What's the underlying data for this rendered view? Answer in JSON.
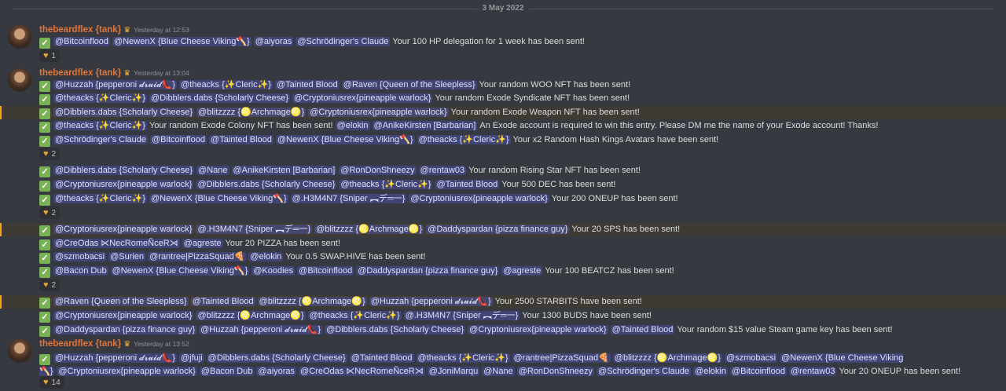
{
  "date_divider": "3 May 2022",
  "groups": [
    {
      "author": "thebeardflex {tank}",
      "timestamp": "Yesterday at 12:53",
      "lines": [
        {
          "mentions": [
            "@Bitcoinflood",
            "@NewenX {Blue Cheese Viking🪓}",
            "@aiyoras",
            "@Schrödinger's Claude"
          ],
          "text": "Your 100 HP delegation for 1 week has been sent!"
        }
      ],
      "reaction_count": "1"
    },
    {
      "author": "thebeardflex {tank}",
      "timestamp": "Yesterday at 13:04",
      "lines": [
        {
          "mentions": [
            "@Huzzah {pepperoni 𝓭𝓻𝓾𝓲𝓭👠}",
            "@theacks {✨Cleric✨}",
            "@Tainted Blood",
            "@Raven {Queen of the Sleepless}"
          ],
          "text": "Your random WOO NFT has been sent!"
        },
        {
          "mentions": [
            "@theacks {✨Cleric✨}",
            "@Dibblers.dabs {Scholarly Cheese}",
            "@Cryptoniusrex{pineapple warlock}"
          ],
          "text": "Your random Exode Syndicate NFT has been sent!"
        },
        {
          "mentions": [
            "@Dibblers.dabs {Scholarly Cheese}",
            "@blitzzzz {♌Archmage♌}",
            "@Cryptoniusrex{pineapple warlock}"
          ],
          "text": "Your random Exode Weapon NFT has been sent!"
        },
        {
          "mentions": [
            "@theacks {✨Cleric✨}"
          ],
          "text": "Your random Exode Colony NFT has been sent!",
          "mentions2": [
            "@elokin",
            "@AnikeKirsten [Barbarian]"
          ],
          "text2": "An Exode account is required to win this entry. Please DM me the name of your Exode account! Thanks!"
        },
        {
          "mentions": [
            "@Schrödinger's Claude",
            "@Bitcoinflood",
            "@Tainted Blood",
            "@NewenX {Blue Cheese Viking🪓}",
            "@theacks {✨Cleric✨}"
          ],
          "text": "Your x2 Random Hash Kings Avatars have been sent!"
        }
      ],
      "reaction_count": "2"
    },
    {
      "lines": [
        {
          "mentions": [
            "@Dibblers.dabs {Scholarly Cheese}",
            "@Nane",
            "@AnikeKirsten [Barbarian]",
            "@RonDonShneezy",
            "@rentaw03"
          ],
          "text": "Your random Rising Star NFT has been sent!"
        },
        {
          "mentions": [
            "@Cryptoniusrex{pineapple warlock}",
            "@Dibblers.dabs {Scholarly Cheese}",
            "@theacks {✨Cleric✨}",
            "@Tainted Blood"
          ],
          "text": "Your 500 DEC has been sent!"
        },
        {
          "mentions": [
            "@theacks {✨Cleric✨}",
            "@NewenX {Blue Cheese Viking🪓}",
            "@.H3M4N7 {Sniper ︻デ═一}",
            "@Cryptoniusrex{pineapple warlock}"
          ],
          "text": "Your 200 ONEUP has been sent!"
        }
      ],
      "reaction_count": "2"
    },
    {
      "lines": [
        {
          "mentions": [
            "@Cryptoniusrex{pineapple warlock}",
            "@.H3M4N7 {Sniper ︻デ═一}",
            "@blitzzzz {♌Archmage♌}",
            "@Daddyspardan {pizza finance guy}"
          ],
          "text": "Your 20 SPS has been sent!"
        },
        {
          "mentions": [
            "@CreOdas ⋉NecRomeÑceR⋊",
            "@agreste"
          ],
          "text": "Your 20 PIZZA has been sent!"
        },
        {
          "mentions": [
            "@szmobacsi",
            "@Surien",
            "@rantree|PizzaSquad🍕",
            "@elokin"
          ],
          "text": "Your 0.5 SWAP.HIVE has been sent!"
        },
        {
          "mentions": [
            "@Bacon Dub",
            "@NewenX {Blue Cheese Viking🪓}",
            "@Koodies",
            "@Bitcoinflood",
            "@Daddyspardan {pizza finance guy}",
            "@agreste"
          ],
          "text": "Your 100 BEATCZ has been sent!"
        }
      ],
      "reaction_count": "2"
    },
    {
      "lines": [
        {
          "mentions": [
            "@Raven {Queen of the Sleepless}",
            "@Tainted Blood",
            "@blitzzzz {♌Archmage♌}",
            "@Huzzah {pepperoni 𝓭𝓻𝓾𝓲𝓭👠}"
          ],
          "text": "Your 2500 STARBITS have been sent!"
        },
        {
          "mentions": [
            "@Cryptoniusrex{pineapple warlock}",
            "@blitzzzz {♌Archmage♌}",
            "@theacks {✨Cleric✨}",
            "@.H3M4N7 {Sniper ︻デ═一}"
          ],
          "text": "Your 1300 BUDS have been sent!"
        },
        {
          "mentions": [
            "@Daddyspardan {pizza finance guy}",
            "@Huzzah {pepperoni 𝓭𝓻𝓾𝓲𝓭👠}",
            "@Dibblers.dabs {Scholarly Cheese}",
            "@Cryptoniusrex{pineapple warlock}",
            "@Tainted Blood"
          ],
          "text": "Your random $15 value Steam game key has been sent!"
        }
      ]
    },
    {
      "author": "thebeardflex {tank}",
      "timestamp": "Yesterday at 13:52",
      "lines": [
        {
          "mentions": [
            "@Huzzah {pepperoni 𝓭𝓻𝓾𝓲𝓭👠}",
            "@jfuji",
            "@Dibblers.dabs {Scholarly Cheese}",
            "@Tainted Blood",
            "@theacks {✨Cleric✨}",
            "@rantree|PizzaSquad🍕",
            "@blitzzzz {♌Archmage♌}",
            "@szmobacsi",
            "@NewenX {Blue Cheese Viking🪓}",
            "@Cryptoniusrex{pineapple warlock}",
            "@Bacon Dub",
            "@aiyoras",
            "@CreOdas ⋉NecRomeÑceR⋊",
            "@JoniMarqu",
            "@Nane",
            "@RonDonShneezy",
            "@Schrödinger's Claude",
            "@elokin",
            "@Bitcoinflood",
            "@rentaw03"
          ],
          "text": "Your 20 ONEUP has been sent!"
        }
      ],
      "reaction_count": "14"
    }
  ]
}
